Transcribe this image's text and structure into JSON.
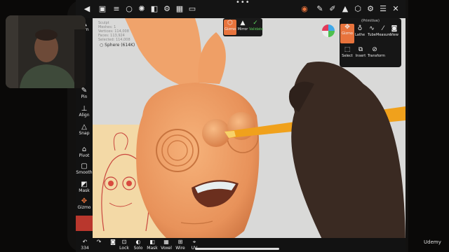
{
  "topbar": {
    "icons": [
      "file-icon",
      "scene-icon",
      "circle-icon",
      "sun-icon",
      "texture-icon",
      "settings-icon",
      "camera-icon"
    ],
    "dots": "•••"
  },
  "stats": {
    "lines": [
      "Sculpt",
      "Meshes: 1",
      "Vertices: 114,008",
      "Faces: 113,924",
      "Selected: 114,008"
    ]
  },
  "scene": {
    "object_label": "Sphere (614K)"
  },
  "gizmo": {
    "items": [
      {
        "label": "Gizmo"
      },
      {
        "label": "Mirror"
      },
      {
        "label": "Validate"
      }
    ]
  },
  "primitive": {
    "title": "(Primitive)",
    "row1": [
      "Gizmo",
      "Lathe",
      "Tube",
      "Measure",
      "View"
    ],
    "row2": [
      "Select",
      "Insert",
      "Transform"
    ]
  },
  "leftbar": {
    "items": [
      "Sym",
      "Pin",
      "Align",
      "Snap",
      "Pivot",
      "Smooth",
      "Mask",
      "Gizmo"
    ]
  },
  "bottombar": {
    "items": [
      {
        "label": "334"
      },
      {
        "label": "Lock"
      },
      {
        "label": "Solo"
      },
      {
        "label": "Mask"
      },
      {
        "label": "Voxel"
      },
      {
        "label": "Wire"
      },
      {
        "label": "UV"
      }
    ]
  },
  "watermark": "Udemy",
  "colors": {
    "accent": "#e8733c",
    "carrot": "#f2a56a",
    "validate": "#5bd15b"
  }
}
